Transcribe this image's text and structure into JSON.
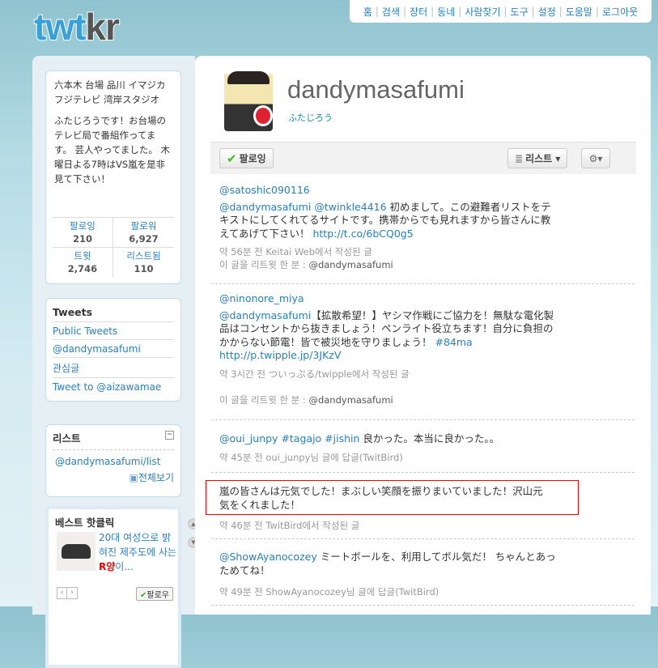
{
  "logo": {
    "tw": "twt",
    "kr": "kr"
  },
  "topnav": [
    "홈",
    "검색",
    "장터",
    "동네",
    "사람찾기",
    "도구",
    "설정",
    "도움말",
    "로그아웃"
  ],
  "bio": {
    "location": "六本木 台場 品川 イマジカ フジテレビ 湾岸スタジオ",
    "description": "ふたじろうです！お台場のテレビ局で番組作ってます。 芸人やってました。 木曜日よる7時はVS嵐を是非見て下さい！"
  },
  "stats": [
    {
      "label": "팔로잉",
      "value": "210"
    },
    {
      "label": "팔로워",
      "value": "6,927"
    },
    {
      "label": "트윗",
      "value": "2,746"
    },
    {
      "label": "리스트됨",
      "value": "110"
    }
  ],
  "tweets_box": {
    "title": "Tweets",
    "items": [
      "Public Tweets",
      "@dandymasafumi",
      "관심글",
      "Tweet to @aizawamae"
    ]
  },
  "list_box": {
    "title": "리스트",
    "item": "@dandymasafumi/list",
    "view_all": "전체보기"
  },
  "ad": {
    "title": "베스트 핫클릭",
    "text_before": "20대 여성으로 밝혀진 제주도에 사는 ",
    "highlight": "R양",
    "text_after": "이...",
    "follow": "팔로우"
  },
  "profile": {
    "username": "dandymasafumi",
    "realname": "ふたじろう"
  },
  "toolbar": {
    "follow": "팔로잉",
    "lists": "리스트 ▾",
    "gear": "⚙▾"
  },
  "timeline": [
    {
      "user": "@satoshic090116",
      "mentions": [
        "@dandymasafumi",
        "@twinkle4416"
      ],
      "text": " 初めまして。この避難者リストをテキストにしてくれてるサイトです。携帯からでも見れますから皆さんに教えてあげて下さい！ ",
      "link": "http://t.co/6bCQ0g5",
      "meta": "약 56분 전 Keitai Web에서 작성된 글",
      "rt_label": "이 글을 리트윗 한 분 : ",
      "rt_user": "@dandymasafumi"
    },
    {
      "user": "@ninonore_miya",
      "mention": "@dandymasafumi",
      "text": "【拡散希望！】ヤシマ作戦にご協力を！無駄な電化製品はコンセントから抜きましょう！ペンライト役立ちます！自分に負担のかからない節電！皆で被災地を守りましょう！",
      "hashtag": "#84ma",
      "link": "http://p.twipple.jp/3JKzV",
      "meta": "약 3시간 전 ついっぷる/twipple에서 작성된 글",
      "rt_label": "이 글을 리트윗 한 분 : ",
      "rt_user": "@dandymasafumi"
    },
    {
      "mention": "@oui_junpy",
      "tags": [
        "#tagajo",
        "#jishin"
      ],
      "text": " 良かった。本当に良かった。。",
      "meta": "약 45분 전 oui_junpy님 글에 답글(TwitBird)"
    },
    {
      "text": "嵐の皆さんは元気でした！まぶしい笑顔を振りまいていました！沢山元気をくれました！",
      "meta": "약 46분 전 TwitBird에서 작성된 글"
    },
    {
      "mention": "@ShowAyanocozey",
      "text": " ミートボールを、利用してボル気だ！ ちゃんとあっためてね！",
      "meta": "약 49분 전 ShowAyanocozey님 글에 답글(TwitBird)"
    }
  ]
}
